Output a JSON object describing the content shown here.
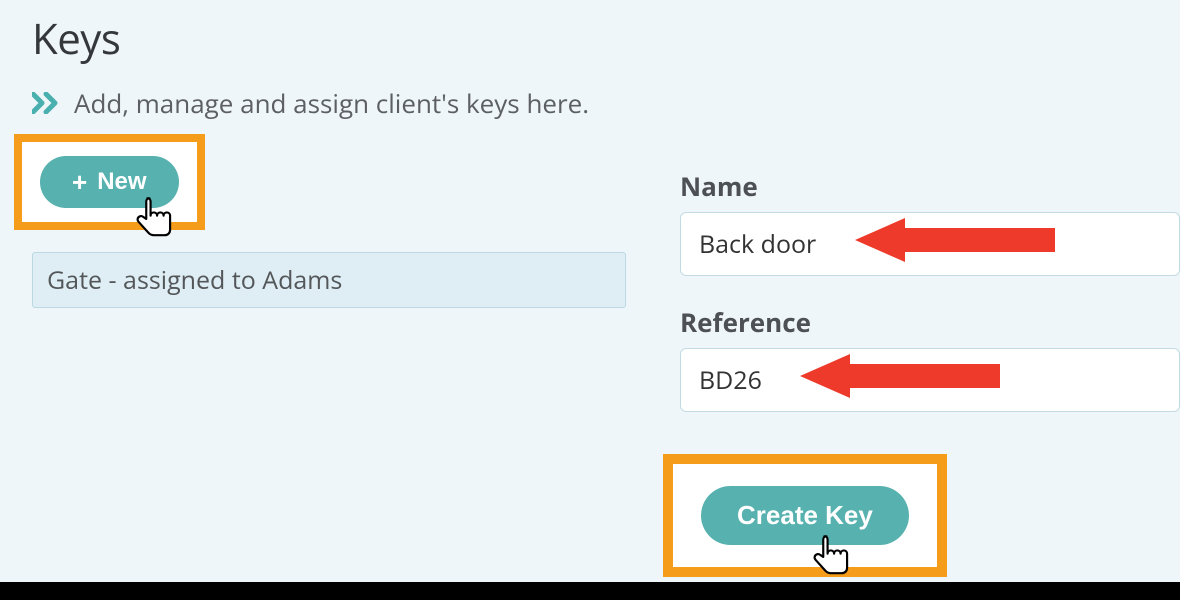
{
  "page": {
    "title": "Keys",
    "subtitle": "Add, manage and assign client's keys here."
  },
  "buttons": {
    "new_label": "New",
    "create_label": "Create Key"
  },
  "list": {
    "item0": "Gate - assigned to Adams"
  },
  "form": {
    "name_label": "Name",
    "name_value": "Back door",
    "reference_label": "Reference",
    "reference_value": "BD26"
  },
  "colors": {
    "accent": "#56b1af",
    "highlight": "#f59c1a",
    "arrow": "#ee3a2b"
  }
}
